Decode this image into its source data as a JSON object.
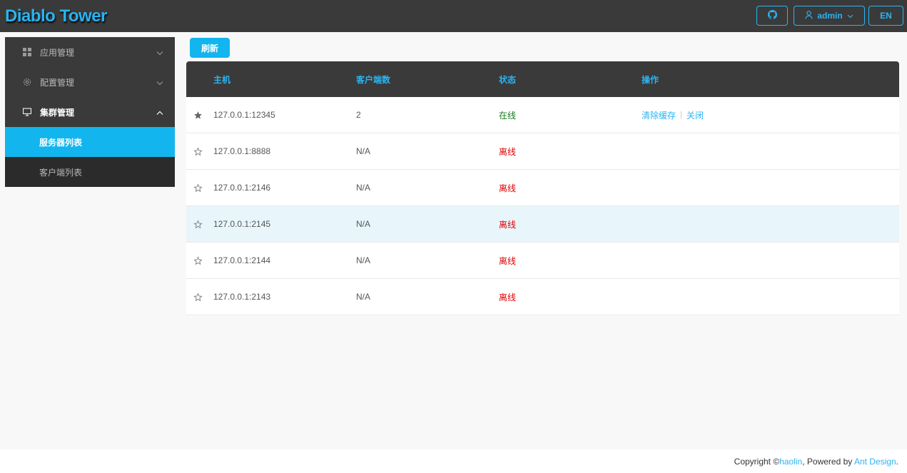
{
  "header": {
    "logo": "Diablo Tower",
    "user": "admin",
    "lang": "EN"
  },
  "sidebar": {
    "items": [
      {
        "label": "应用管理",
        "icon": "appstore-icon",
        "expanded": false
      },
      {
        "label": "配置管理",
        "icon": "setting-icon",
        "expanded": false
      },
      {
        "label": "集群管理",
        "icon": "desktop-icon",
        "expanded": true,
        "children": [
          {
            "label": "服务器列表",
            "active": true
          },
          {
            "label": "客户端列表",
            "active": false
          }
        ]
      }
    ]
  },
  "toolbar": {
    "refresh_label": "刷新"
  },
  "table": {
    "headers": [
      "主机",
      "客户端数",
      "状态",
      "操作"
    ],
    "rows": [
      {
        "starred": true,
        "host": "127.0.0.1:12345",
        "clients": "2",
        "status": "在线",
        "online": true
      },
      {
        "starred": false,
        "host": "127.0.0.1:8888",
        "clients": "N/A",
        "status": "离线",
        "online": false
      },
      {
        "starred": false,
        "host": "127.0.0.1:2146",
        "clients": "N/A",
        "status": "离线",
        "online": false
      },
      {
        "starred": false,
        "host": "127.0.0.1:2145",
        "clients": "N/A",
        "status": "离线",
        "online": false
      },
      {
        "starred": false,
        "host": "127.0.0.1:2144",
        "clients": "N/A",
        "status": "离线",
        "online": false
      },
      {
        "starred": false,
        "host": "127.0.0.1:2143",
        "clients": "N/A",
        "status": "离线",
        "online": false
      }
    ],
    "actions": {
      "clear_cache": "清除缓存",
      "close": "关闭"
    }
  },
  "footer": {
    "copyright": "Copyright  ©",
    "author": "haolin",
    "powered_by": ", Powered by ",
    "framework": "Ant Design",
    "period": "."
  },
  "colors": {
    "accent": "#12b5ee",
    "dark": "#3a3a3a",
    "online": "#1a7a1a",
    "offline": "#e00000"
  }
}
